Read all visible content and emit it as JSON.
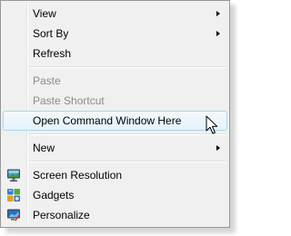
{
  "menu": {
    "items": [
      {
        "label": "View",
        "submenu": true
      },
      {
        "label": "Sort By",
        "submenu": true
      },
      {
        "label": "Refresh"
      },
      {
        "label": "Paste",
        "disabled": true
      },
      {
        "label": "Paste Shortcut",
        "disabled": true
      },
      {
        "label": "Open Command Window Here",
        "highlighted": true
      },
      {
        "label": "New",
        "submenu": true
      },
      {
        "label": "Screen Resolution",
        "icon": "monitor-icon"
      },
      {
        "label": "Gadgets",
        "icon": "gadgets-icon"
      },
      {
        "label": "Personalize",
        "icon": "personalize-icon"
      }
    ]
  },
  "colors": {
    "menu_background": "#f0f0f0",
    "menu_border": "#979797",
    "highlight_border": "#a8d8eb",
    "disabled_text": "#8c8c8c"
  },
  "cursor": "arrow-cursor-icon"
}
